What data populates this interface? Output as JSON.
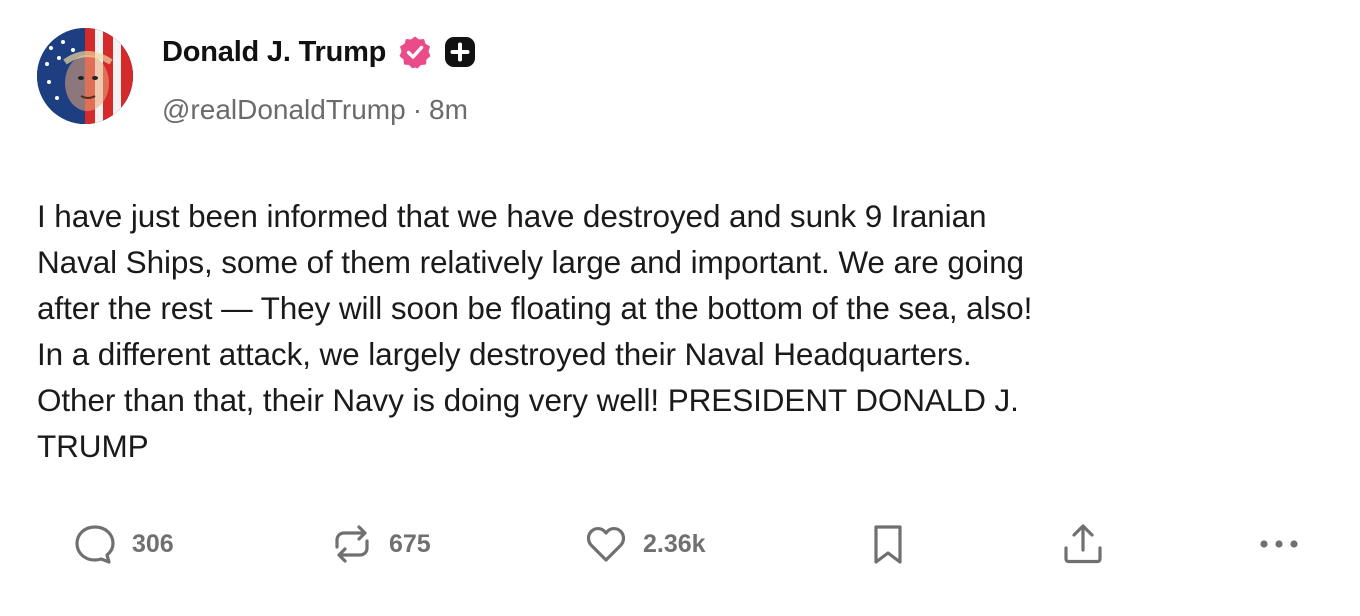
{
  "author": {
    "display_name": "Donald J. Trump",
    "handle": "@realDonaldTrump",
    "separator": "·",
    "time_ago": "8m",
    "verified_badge_color": "#ea4c89",
    "plus_badge_color": "#111111"
  },
  "post": {
    "text": "I have just been informed that we have destroyed and sunk 9 Iranian\nNaval Ships, some of them relatively large and important. We are going\nafter the rest — They will soon be floating at the bottom of the sea, also!\nIn a different attack, we largely destroyed their Naval Headquarters.\nOther than that, their Navy is doing very well! PRESIDENT DONALD J.\nTRUMP"
  },
  "actions": {
    "reply": {
      "icon": "comment-icon",
      "count": "306"
    },
    "retruth": {
      "icon": "repost-icon",
      "count": "675"
    },
    "like": {
      "icon": "heart-icon",
      "count": "2.36k"
    },
    "bookmark": {
      "icon": "bookmark-icon"
    },
    "share": {
      "icon": "share-icon"
    },
    "more": {
      "icon": "more-icon"
    }
  },
  "colors": {
    "text_primary": "#111111",
    "text_secondary": "#6b6b6b",
    "icon_gray": "#707070"
  }
}
